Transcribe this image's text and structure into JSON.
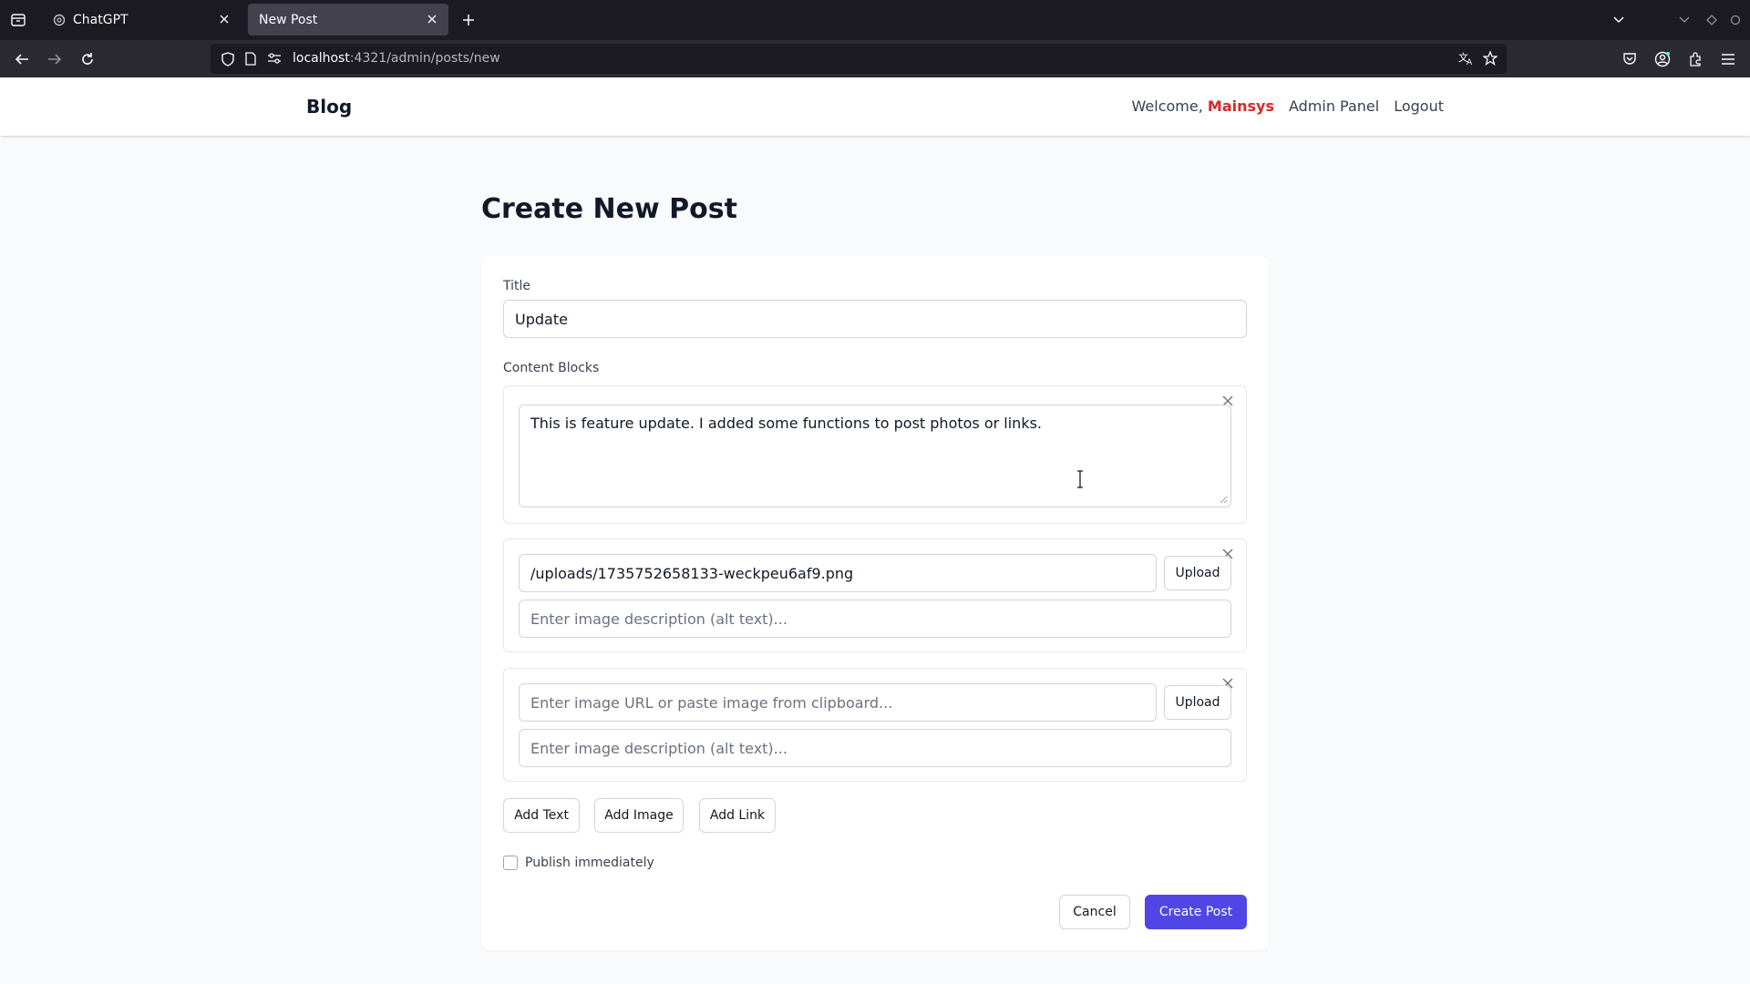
{
  "browser": {
    "tabs": [
      {
        "title": "ChatGPT",
        "active": false
      },
      {
        "title": "New Post",
        "active": true
      }
    ],
    "url_host": "localhost",
    "url_path": ":4321/admin/posts/new"
  },
  "header": {
    "brand": "Blog",
    "welcome_prefix": "Welcome,",
    "username": "Mainsys",
    "admin_panel": "Admin Panel",
    "logout": "Logout"
  },
  "page": {
    "title": "Create New Post"
  },
  "form": {
    "title_label": "Title",
    "title_value": "Update",
    "content_label": "Content Blocks",
    "blocks": [
      {
        "type": "text",
        "value": "This is feature update. I added some functions to post photos or links."
      },
      {
        "type": "image",
        "url_value": "/uploads/1735752658133-weckpeu6af9.png",
        "url_placeholder": "",
        "alt_placeholder": "Enter image description (alt text)...",
        "upload_label": "Upload"
      },
      {
        "type": "image",
        "url_value": "",
        "url_placeholder": "Enter image URL or paste image from clipboard...",
        "alt_placeholder": "Enter image description (alt text)...",
        "upload_label": "Upload"
      }
    ],
    "add_text": "Add Text",
    "add_image": "Add Image",
    "add_link": "Add Link",
    "publish_label": "Publish immediately",
    "publish_checked": false,
    "cancel": "Cancel",
    "submit": "Create Post"
  },
  "colors": {
    "primary": "#4f46e5",
    "username": "#dc2626"
  }
}
